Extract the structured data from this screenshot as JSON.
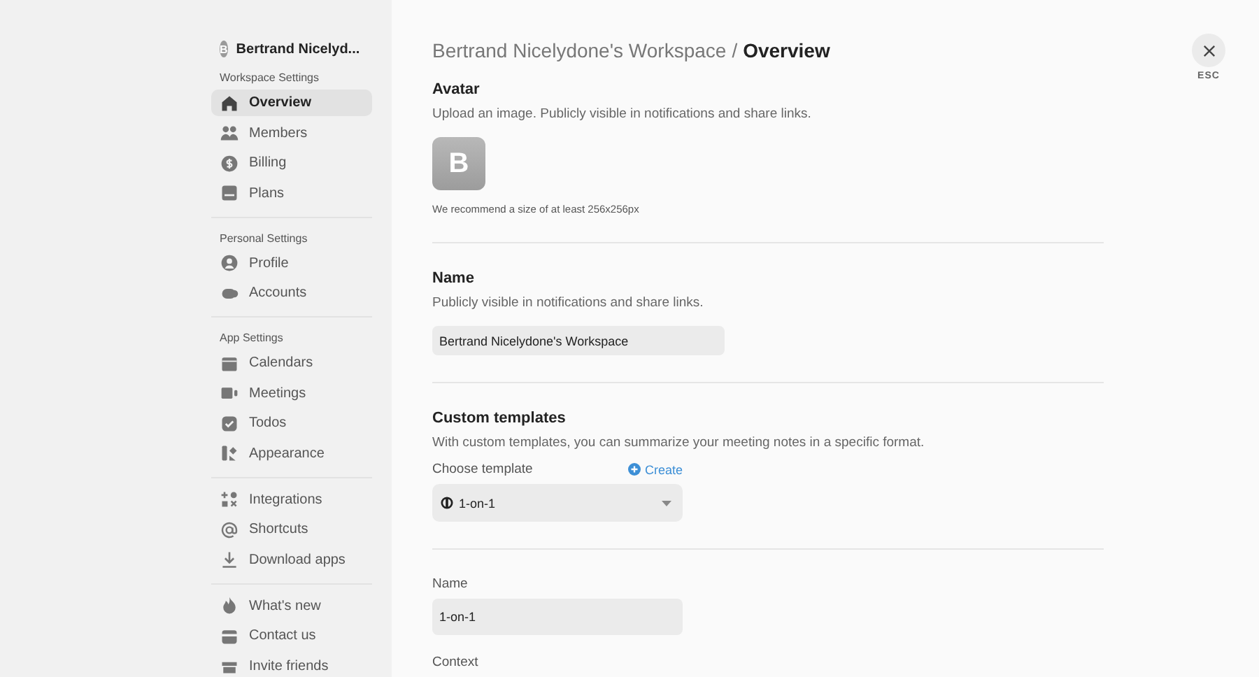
{
  "sidebar": {
    "workspace": {
      "avatar": "B",
      "name": "Bertrand Nicelyd..."
    },
    "sections": [
      {
        "title": "Workspace Settings",
        "items": [
          {
            "label": "Overview",
            "selected": true
          },
          {
            "label": "Members",
            "selected": false
          },
          {
            "label": "Billing",
            "selected": false
          },
          {
            "label": "Plans",
            "selected": false
          }
        ]
      },
      {
        "title": "Personal Settings",
        "items": [
          {
            "label": "Profile",
            "selected": false
          },
          {
            "label": "Accounts",
            "selected": false
          }
        ]
      },
      {
        "title": "App Settings",
        "items": [
          {
            "label": "Calendars",
            "selected": false
          },
          {
            "label": "Meetings",
            "selected": false
          },
          {
            "label": "Todos",
            "selected": false
          },
          {
            "label": "Appearance",
            "selected": false
          }
        ]
      },
      {
        "items": [
          {
            "label": "Integrations",
            "selected": false
          },
          {
            "label": "Shortcuts",
            "selected": false
          },
          {
            "label": "Download apps",
            "selected": false
          }
        ]
      },
      {
        "items": [
          {
            "label": "What's new",
            "selected": false
          },
          {
            "label": "Contact us",
            "selected": false
          },
          {
            "label": "Invite friends",
            "selected": false
          }
        ]
      }
    ]
  },
  "breadcrumb": {
    "parent": "Bertrand Nicelydone's Workspace",
    "separator": "/",
    "current": "Overview"
  },
  "close": {
    "label": "ESC"
  },
  "sections": [
    {
      "title": "Avatar",
      "description": "Upload an image. Publicly visible in notifications and share links.",
      "avatar": "B",
      "hint": "We recommend a size of at least 256x256px"
    },
    {
      "title": "Name",
      "description": "Publicly visible in notifications and share links.",
      "value": "Bertrand Nicelydone's Workspace"
    },
    {
      "title": "Custom templates",
      "description": "With custom templates, you can summarize your meeting notes in a specific format.",
      "choose_label": "Choose template",
      "create_label": "Create",
      "template": "1-on-1"
    },
    {
      "fields": [
        {
          "label": "Name",
          "value": "1-on-1"
        },
        {
          "label": "Context"
        }
      ]
    }
  ]
}
